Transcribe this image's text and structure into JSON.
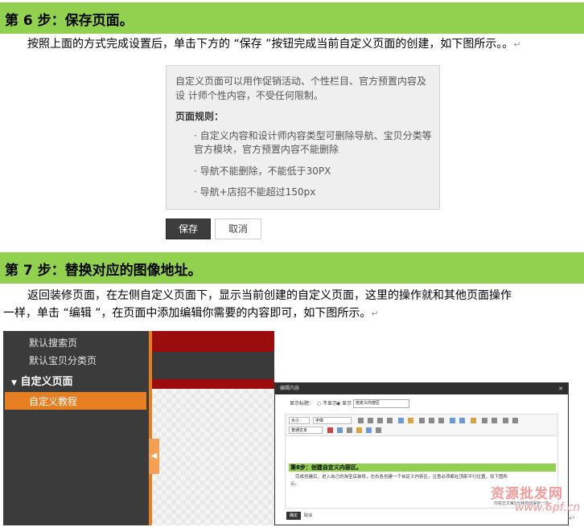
{
  "step6": {
    "title": "第 6 步：保存页面。",
    "text": "按照上面的方式完成设置后，单击下方的 “保存 ”按钮完成当前自定义页面的创建，如下图所示。",
    "text_end": "。",
    "para_mark": "↵",
    "box": {
      "line1": "自定义页面可以用作促销活动、个性栏目、官方预置内容及",
      "line2": "设 计师个性内容，不受任何限制。",
      "rules_heading": "页面规则：",
      "rule1_a": "· 自定义内容和设计师内容类型可删除导航、宝贝分类等",
      "rule1_b": "官方模块，官方预置内容不能删除",
      "rule2": "· 导航不能删除，不能低于30PX",
      "rule3": "· 导航+店招不能超过150px"
    },
    "save_label": "保存",
    "cancel_label": "取消"
  },
  "step7": {
    "title": "第 7 步：替换对应的图像地址。",
    "line1": "返回装修页面，在左侧自定义页面下，显示当前创建的自定义页面，这里的操作就和其他页面操作",
    "line2": "一样，单击 “编辑 ”，在页面中添加编辑你需要的内容即可，如下图所示。",
    "para_mark": "↵"
  },
  "shot": {
    "sidebar": {
      "item1": "默认搜索页",
      "item2": "默认宝贝分类页",
      "group": "自定义页面",
      "active": "自定义教程"
    },
    "dialog": {
      "title": "编辑内容",
      "close": "✕",
      "show_title_label": "显示标题：",
      "opt_hide": "不显示",
      "opt_show": "显示",
      "title_value": "自定义内容区",
      "font_size": "大小",
      "font_family": "字体",
      "paragraph": "普通文本",
      "green_heading": "第8步：创建自定义内容区。",
      "body_line1": "完成创建后，进入自己的淘宝店装修，左右各创建一个自定义内容区，注意必须都在顶部平行位置，如下图所",
      "body_line2": "示。",
      "status": "内容正文每5分钟自动保存一次。",
      "ok": "确定",
      "cancel": "取消"
    }
  },
  "watermark": {
    "line1": "资源批发网",
    "line2": "www.6pf.cn"
  },
  "colors": {
    "step_bar": "#92d050",
    "sidebar_bg": "#3b3b3b",
    "accent_orange": "#e67e22",
    "dark_red": "#9b0d0d"
  }
}
